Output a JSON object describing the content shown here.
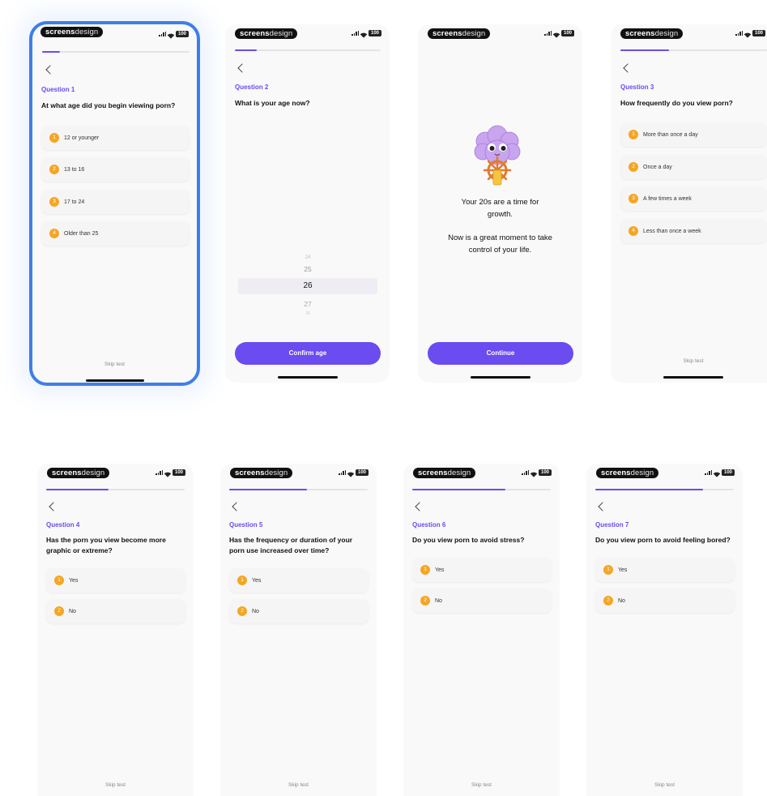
{
  "brand": {
    "bold": "screens",
    "regular": "design"
  },
  "status": {
    "battery": "100"
  },
  "skip_label": "Skip test",
  "screen1": {
    "question_label": "Question 1",
    "question_text": "At what age did you begin viewing porn?",
    "progress": 0.12,
    "options": [
      {
        "num": "1",
        "label": "12 or younger"
      },
      {
        "num": "2",
        "label": "13 to 16"
      },
      {
        "num": "3",
        "label": "17 to 24"
      },
      {
        "num": "4",
        "label": "Older than 25"
      }
    ]
  },
  "screen2": {
    "question_label": "Question 2",
    "question_text": "What is your age now?",
    "progress": 0.15,
    "picker": [
      "24",
      "25",
      "26",
      "27",
      "28"
    ],
    "selected_age": "26",
    "button_label": "Confirm age"
  },
  "screen3": {
    "message_line1": "Your 20s are a time for growth.",
    "message_line2": "Now is a great moment to take control of your life.",
    "button_label": "Continue"
  },
  "screen4": {
    "question_label": "Question 3",
    "question_text": "How frequently do you view porn?",
    "progress": 0.33,
    "options": [
      {
        "num": "1",
        "label": "More than once a day"
      },
      {
        "num": "2",
        "label": "Once a day"
      },
      {
        "num": "3",
        "label": "A few times a week"
      },
      {
        "num": "4",
        "label": "Less than once a week"
      }
    ]
  },
  "screen5": {
    "question_label": "Question 4",
    "question_text": "Has the porn you view become more graphic or extreme?",
    "progress": 0.45,
    "options": [
      {
        "num": "1",
        "label": "Yes"
      },
      {
        "num": "2",
        "label": "No"
      }
    ]
  },
  "screen6": {
    "question_label": "Question 5",
    "question_text": "Has the frequency or duration of your porn use increased over time?",
    "progress": 0.56,
    "options": [
      {
        "num": "1",
        "label": "Yes"
      },
      {
        "num": "2",
        "label": "No"
      }
    ]
  },
  "screen7": {
    "question_label": "Question 6",
    "question_text": "Do you view porn to avoid stress?",
    "progress": 0.67,
    "options": [
      {
        "num": "1",
        "label": "Yes"
      },
      {
        "num": "2",
        "label": "No"
      }
    ]
  },
  "screen8": {
    "question_label": "Question 7",
    "question_text": "Do you view porn to avoid feeling bored?",
    "progress": 0.78,
    "options": [
      {
        "num": "1",
        "label": "Yes"
      },
      {
        "num": "2",
        "label": "No"
      }
    ]
  },
  "colors": {
    "accent": "#6a4cf0",
    "badge": "#f5a623",
    "selection": "#3f7ee8"
  },
  "icons": {
    "back": "chevron-left-icon",
    "signal": "signal-icon",
    "wifi": "wifi-icon",
    "battery": "battery-icon",
    "mascot": "brain-mascot-icon"
  }
}
